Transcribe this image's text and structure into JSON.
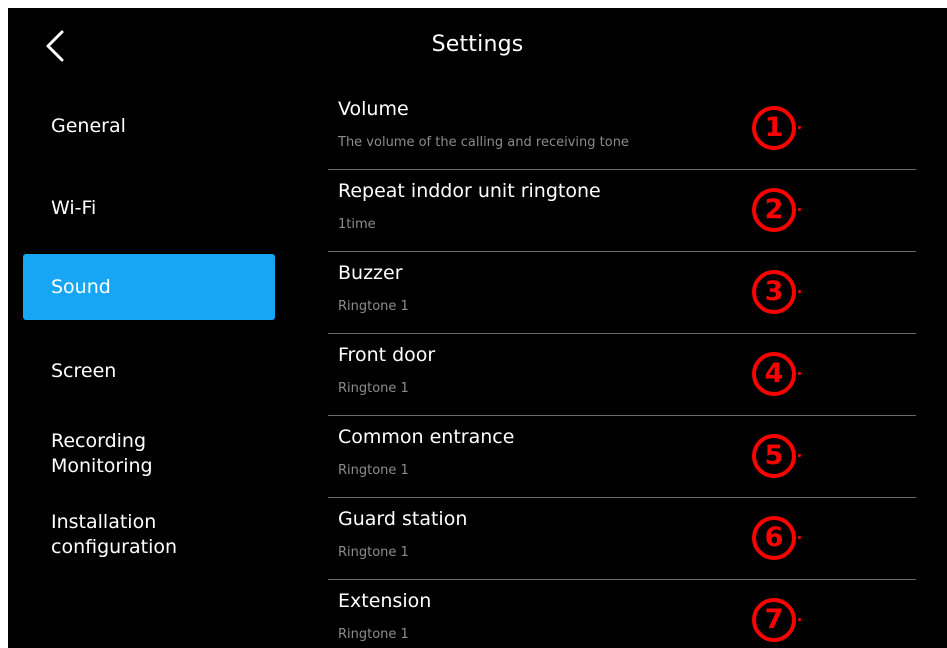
{
  "header": {
    "title": "Settings"
  },
  "sidebar": {
    "items": [
      {
        "label": "General"
      },
      {
        "label": "Wi-Fi"
      },
      {
        "label": "Sound",
        "active": true
      },
      {
        "label": "Screen"
      },
      {
        "label": "Recording\nMonitoring"
      },
      {
        "label": "Installation\nconfiguration"
      }
    ]
  },
  "settings": {
    "rows": [
      {
        "label": "Volume",
        "sub": "The volume of the calling and receiving tone",
        "marker": "1"
      },
      {
        "label": "Repeat inddor unit ringtone",
        "sub": "1time",
        "marker": "2"
      },
      {
        "label": "Buzzer",
        "sub": "Ringtone 1",
        "marker": "3"
      },
      {
        "label": "Front door",
        "sub": "Ringtone 1",
        "marker": "4"
      },
      {
        "label": "Common entrance",
        "sub": "Ringtone 1",
        "marker": "5"
      },
      {
        "label": "Guard station",
        "sub": "Ringtone 1",
        "marker": "6"
      },
      {
        "label": "Extension",
        "sub": "Ringtone 1",
        "marker": "7"
      }
    ]
  },
  "colors": {
    "background": "#000000",
    "accent": "#17a6f3",
    "annotation": "#ff0000",
    "subtext": "#8c8c8c"
  },
  "icons": {
    "back": "chevron-left-icon"
  }
}
